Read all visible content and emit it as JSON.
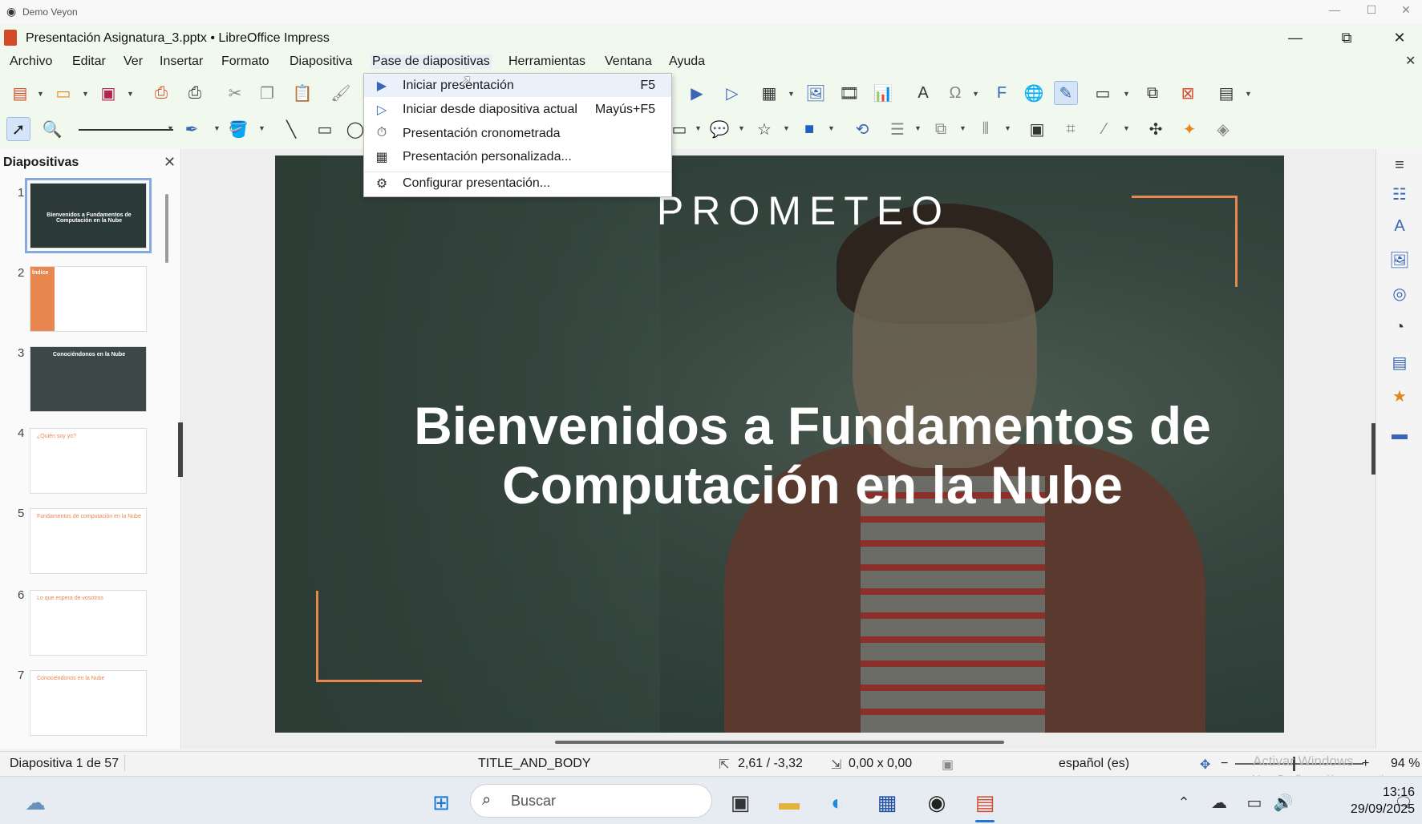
{
  "veyon": {
    "title": "Demo Veyon",
    "min": "—",
    "max": "☐",
    "close": "✕"
  },
  "window": {
    "title": "Presentación Asignatura_3.pptx • LibreOffice Impress",
    "min": "—",
    "restore": "⧉",
    "close": "✕"
  },
  "menubar": [
    "Archivo",
    "Editar",
    "Ver",
    "Insertar",
    "Formato",
    "Diapositiva",
    "Pase de diapositivas",
    "Herramientas",
    "Ventana",
    "Ayuda"
  ],
  "dropdown": {
    "items": [
      {
        "label": "Iniciar presentación",
        "shortcut": "F5",
        "icon": "start-presentation-icon"
      },
      {
        "label": "Iniciar desde diapositiva actual",
        "shortcut": "Mayús+F5",
        "icon": "start-current-slide-icon"
      },
      {
        "label": "Presentación cronometrada",
        "shortcut": "",
        "icon": "rehearse-timings-icon"
      },
      {
        "label": "Presentación personalizada...",
        "shortcut": "",
        "icon": "custom-show-icon"
      },
      {
        "label": "Configurar presentación...",
        "shortcut": "",
        "icon": "slideshow-settings-icon"
      }
    ]
  },
  "slides_pane": {
    "header": "Diapositivas",
    "close": "✕",
    "thumbs": [
      {
        "num": "1",
        "title": "Bienvenidos a Fundamentos de Computación en la Nube"
      },
      {
        "num": "2",
        "title": "Índice"
      },
      {
        "num": "3",
        "title": "Conociéndonos en la Nube"
      },
      {
        "num": "4",
        "title": "¿Quién soy yo?"
      },
      {
        "num": "5",
        "title": "Fundamentos de computación en la Nube"
      },
      {
        "num": "6",
        "title": "Lo que espera de vosotros"
      },
      {
        "num": "7",
        "title": "Conociéndonos en la Nube"
      }
    ]
  },
  "slide": {
    "brand": "PROMETEO",
    "headline_line1": "Bienvenidos a Fundamentos de",
    "headline_line2": "Computación en la Nube"
  },
  "status": {
    "slide": "Diapositiva 1 de 57",
    "layout": "TITLE_AND_BODY",
    "position": "2,61 / -3,32",
    "size": "0,00 x 0,00",
    "language": "español (es)",
    "zoom": "94 %",
    "watermark": "Activar Windows",
    "watermark_sub": "Ve a Configuración para activar"
  },
  "taskbar": {
    "search_placeholder": "Buscar",
    "time": "13:16",
    "date": "29/09/2025"
  },
  "colors": {
    "accent": "#e8874f",
    "toolbar_bg": "#f1f9ee",
    "selection": "#87a9e0"
  }
}
